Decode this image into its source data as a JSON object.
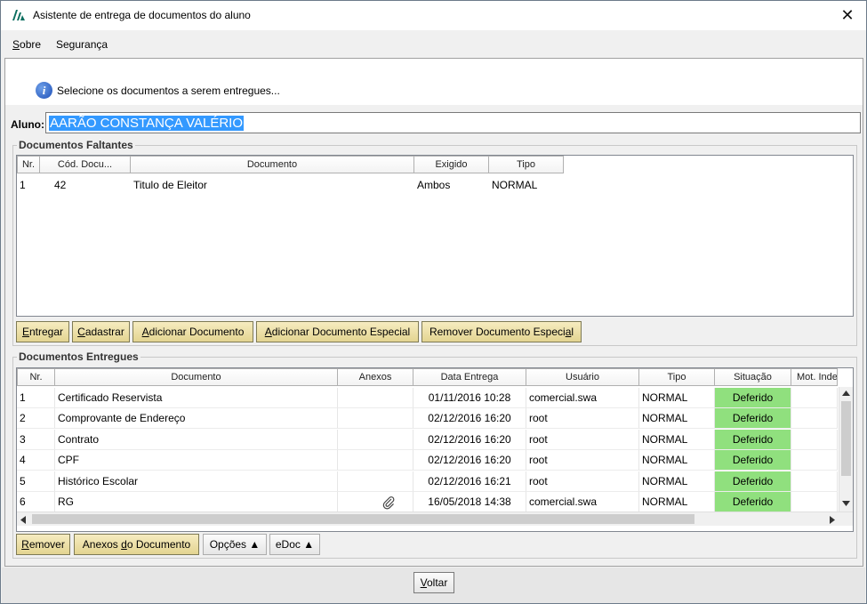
{
  "window": {
    "title": "Asistente de entrega de documentos do aluno",
    "close_glyph": "✕"
  },
  "menu": {
    "items": [
      {
        "label": "Sobre",
        "underline": "S"
      },
      {
        "label": "Segurança",
        "underline": ""
      }
    ]
  },
  "info": {
    "icon": "info-icon",
    "text": "Selecione os documentos a serem entregues..."
  },
  "aluno": {
    "label": "Aluno:",
    "value": "AARÃO CONSTANÇA VALÉRIO"
  },
  "faltantes": {
    "legend": "Documentos Faltantes",
    "columns": [
      "Nr.",
      "Cód. Docu...",
      "Documento",
      "Exigido",
      "Tipo"
    ],
    "rows": [
      {
        "nr": "1",
        "cod": "42",
        "documento": "Titulo de Eleitor",
        "exigido": "Ambos",
        "tipo": "NORMAL"
      }
    ],
    "buttons": {
      "entregar": "Entregar",
      "cadastrar": "Cadastrar",
      "adicionar": "Adicionar Documento",
      "adicionar_especial": "Adicionar Documento Especial",
      "remover_especial": "Remover Documento Especial"
    }
  },
  "entregues": {
    "legend": "Documentos Entregues",
    "columns": [
      "Nr.",
      "Documento",
      "Anexos",
      "Data Entrega",
      "Usuário",
      "Tipo",
      "Situação",
      "Mot. Inde"
    ],
    "rows": [
      {
        "nr": "1",
        "documento": "Certificado Reservista",
        "anexos": "",
        "data": "01/11/2016 10:28",
        "usuario": "comercial.swa",
        "tipo": "NORMAL",
        "situacao": "Deferido"
      },
      {
        "nr": "2",
        "documento": "Comprovante de Endereço",
        "anexos": "",
        "data": "02/12/2016 16:20",
        "usuario": "root",
        "tipo": "NORMAL",
        "situacao": "Deferido"
      },
      {
        "nr": "3",
        "documento": "Contrato",
        "anexos": "",
        "data": "02/12/2016 16:20",
        "usuario": "root",
        "tipo": "NORMAL",
        "situacao": "Deferido"
      },
      {
        "nr": "4",
        "documento": "CPF",
        "anexos": "",
        "data": "02/12/2016 16:20",
        "usuario": "root",
        "tipo": "NORMAL",
        "situacao": "Deferido"
      },
      {
        "nr": "5",
        "documento": "Histórico Escolar",
        "anexos": "",
        "data": "02/12/2016 16:21",
        "usuario": "root",
        "tipo": "NORMAL",
        "situacao": "Deferido"
      },
      {
        "nr": "6",
        "documento": "RG",
        "anexos": "paperclip-icon",
        "data": "16/05/2018 14:38",
        "usuario": "comercial.swa",
        "tipo": "NORMAL",
        "situacao": "Deferido"
      }
    ],
    "buttons": {
      "remover": "Remover",
      "anexos": "Anexos do Documento",
      "opcoes": "Opções",
      "edoc": "eDoc"
    }
  },
  "footer": {
    "voltar": "Voltar"
  },
  "colors": {
    "accent_button": "#e3d491",
    "status_deferido": "#90e07e",
    "selection": "#3399ff"
  }
}
